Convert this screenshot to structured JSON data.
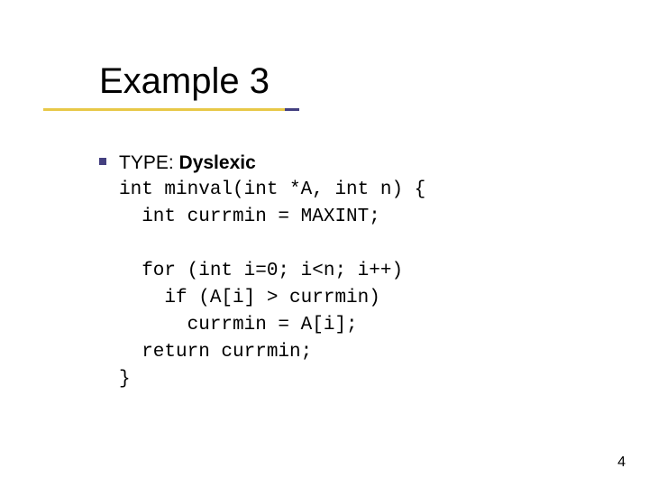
{
  "title": "Example 3",
  "type_prefix": "TYPE: ",
  "type_value": "Dyslexic",
  "code_block1": "int minval(int *A, int n) {\n  int currmin = MAXINT;",
  "code_block2": "  for (int i=0; i<n; i++)\n    if (A[i] > currmin)\n      currmin = A[i];\n  return currmin;\n}",
  "page_number": "4"
}
